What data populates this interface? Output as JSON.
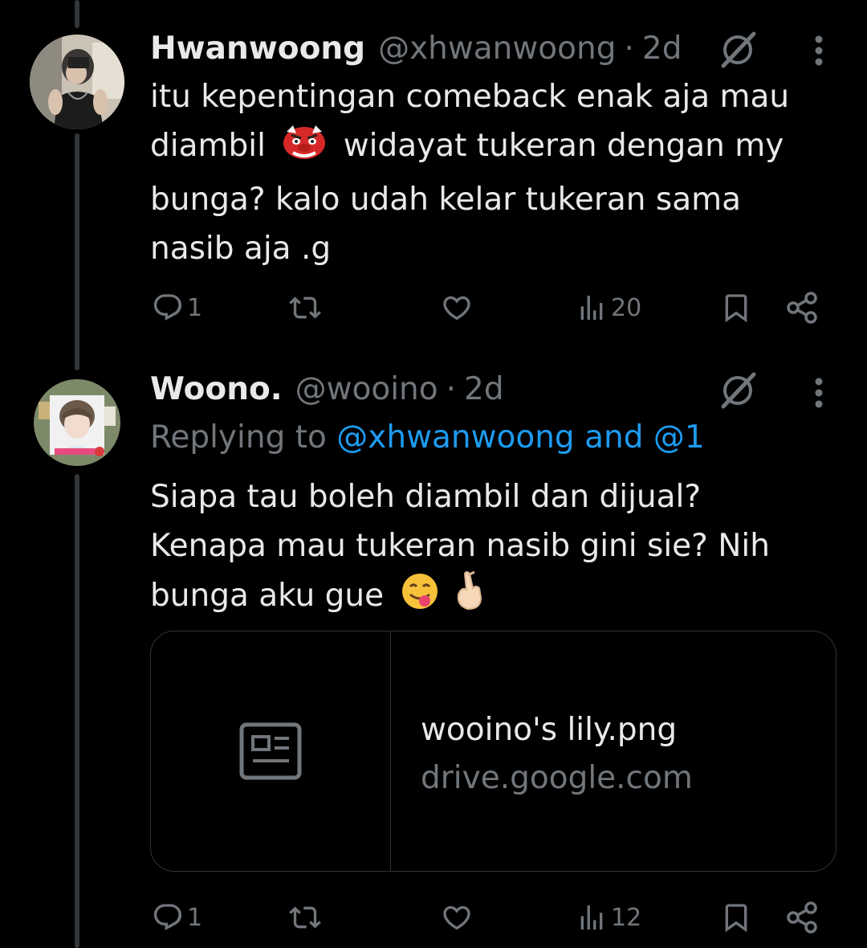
{
  "tweets": [
    {
      "name": "Hwanwoong",
      "handle": "@xhwanwoong",
      "separator": "·",
      "time": "2d",
      "text_lines": [
        "itu kepentingan comeback enak aja mau",
        "diambil",
        "widayat tukeran dengan my",
        "bunga? kalo udah kelar tukeran sama",
        "nasib aja .g"
      ],
      "inline_emoji": "goblin-mask-emoji",
      "replies": "1",
      "views": "20"
    },
    {
      "name": "Woono.",
      "handle": "@wooino",
      "separator": "·",
      "time": "2d",
      "replying_prefix": "Replying to",
      "replying_mentions": "@xhwanwoong and @1",
      "text_lines": [
        "Siapa tau boleh diambil dan dijual?",
        "Kenapa mau tukeran nasib gini sie? Nih",
        "bunga aku gue"
      ],
      "trailing_emojis": [
        "face-savoring-food-emoji",
        "hand-with-index-finger-and-thumb-crossed-emoji"
      ],
      "card": {
        "title": "wooino's lily.png",
        "domain": "drive.google.com",
        "icon": "article-icon"
      },
      "replies": "1",
      "views": "12"
    }
  ],
  "colors": {
    "background": "#000000",
    "text": "#e7e9ea",
    "muted": "#71767b",
    "link": "#1d9bf0",
    "border": "#2f3336"
  }
}
